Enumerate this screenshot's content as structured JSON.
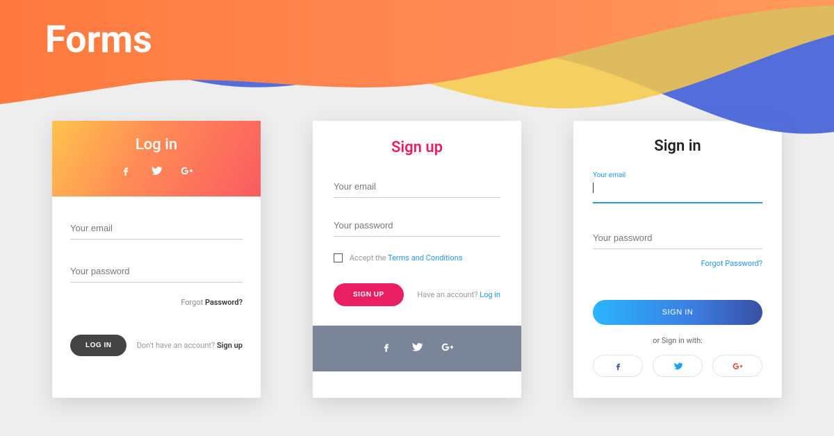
{
  "page_title": "Forms",
  "card1": {
    "title": "Log in",
    "email_placeholder": "Your email",
    "password_placeholder": "Your password",
    "forgot_prefix": "Forgot ",
    "forgot_bold": "Password?",
    "button": "LOG IN",
    "switch_text": "Don't have an account? ",
    "switch_link": "Sign up"
  },
  "card2": {
    "title": "Sign up",
    "email_placeholder": "Your email",
    "password_placeholder": "Your password",
    "terms_text": "Accept the ",
    "terms_link": "Terms and Conditions",
    "button": "SIGN UP",
    "switch_text": "Have an account? ",
    "switch_link": "Log in"
  },
  "card3": {
    "title": "Sign in",
    "email_label": "Your email",
    "password_placeholder": "Your password",
    "forgot": "Forgot Password?",
    "button": "SIGN IN",
    "or_text": "or Sign in with:"
  },
  "icons": {
    "facebook": "facebook-icon",
    "twitter": "twitter-icon",
    "google_plus": "google-plus-icon"
  }
}
